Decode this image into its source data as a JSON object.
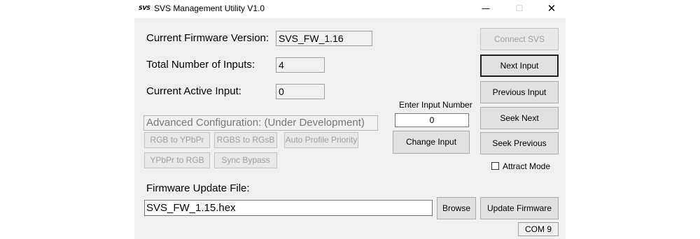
{
  "window": {
    "logo_text": "SVS",
    "title": "SVS Management Utility V1.0",
    "minimize_glyph": "—",
    "maximize_glyph": "☐",
    "close_glyph": "✕"
  },
  "info": {
    "firmware_version_label": "Current Firmware Version:",
    "firmware_version_value": "SVS_FW_1.16",
    "total_inputs_label": "Total Number of Inputs:",
    "total_inputs_value": "4",
    "active_input_label": "Current Active Input:",
    "active_input_value": "0"
  },
  "advanced": {
    "title": "Advanced Configuration: (Under Development)",
    "buttons": {
      "rgb_to_ypbpr": "RGB to YPbPr",
      "rgbs_to_rgsb": "RGBS to RGsB",
      "auto_profile_priority": "Auto Profile Priority",
      "ypbpr_to_rgb": "YPbPr to RGB",
      "sync_bypass": "Sync Bypass"
    }
  },
  "input_entry": {
    "label": "Enter Input Number",
    "value": "0",
    "change_button": "Change Input"
  },
  "right_panel": {
    "connect": "Connect SVS",
    "next_input": "Next Input",
    "previous_input": "Previous Input",
    "seek_next": "Seek Next",
    "seek_previous": "Seek Previous",
    "attract_mode_label": "Attract Mode",
    "attract_mode_checked": false
  },
  "firmware_update": {
    "label": "Firmware Update File:",
    "file_value": "SVS_FW_1.15.hex",
    "browse_button": "Browse",
    "update_button": "Update Firmware"
  },
  "status": {
    "port": "COM 9"
  }
}
